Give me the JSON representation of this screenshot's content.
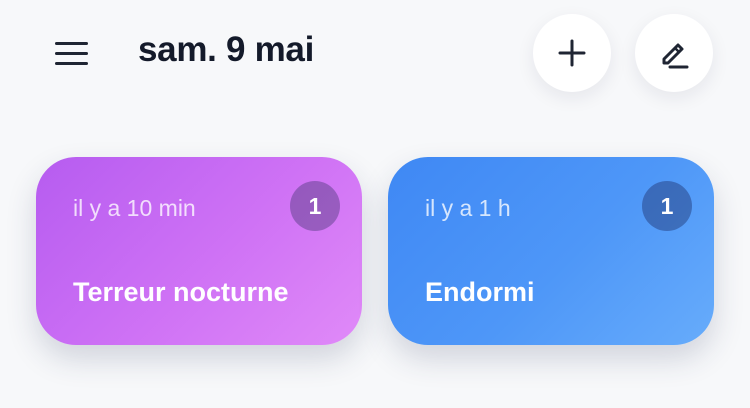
{
  "header": {
    "date_title": "sam. 9 mai",
    "menu_icon": "hamburger-menu-icon",
    "add_icon": "plus-icon",
    "edit_icon": "pencil-icon"
  },
  "cards": [
    {
      "time_ago": "il y a 10 min",
      "count": "1",
      "title": "Terreur nocturne",
      "color": "#c26af3"
    },
    {
      "time_ago": "il y a 1 h",
      "count": "1",
      "title": "Endormi",
      "color": "#4e97f8"
    }
  ],
  "colors": {
    "background": "#f7f8fa",
    "text_dark": "#141a2a"
  }
}
